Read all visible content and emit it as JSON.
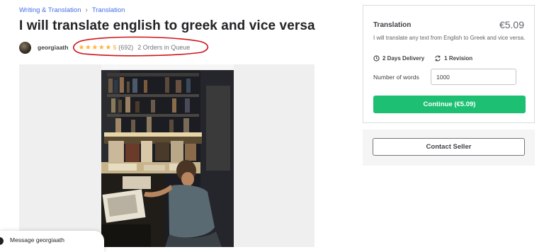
{
  "breadcrumb": {
    "category": "Writing & Translation",
    "subcategory": "Translation"
  },
  "gig": {
    "title": "I will translate english to greek and vice versa"
  },
  "seller": {
    "name": "georgiaath",
    "rating": "5",
    "reviews": "(692)",
    "queue": "2 Orders in Queue"
  },
  "package": {
    "name": "Translation",
    "price": "€5.09",
    "description": "I will translate any text from English to Greek and vice versa.",
    "delivery": "2 Days Delivery",
    "revisions": "1 Revision",
    "words_label": "Number of words",
    "words_value": "1000",
    "continue_label": "Continue (€5.09)"
  },
  "contact": {
    "label": "Contact Seller"
  },
  "message": {
    "label": "Message georgiaath"
  },
  "colors": {
    "accent_green": "#1dbf73",
    "star": "#ffb33e",
    "link": "#446ee7",
    "annotation": "#d0141a"
  },
  "icons": [
    "chevron-right-icon",
    "star-icon",
    "clock-icon",
    "refresh-icon"
  ]
}
